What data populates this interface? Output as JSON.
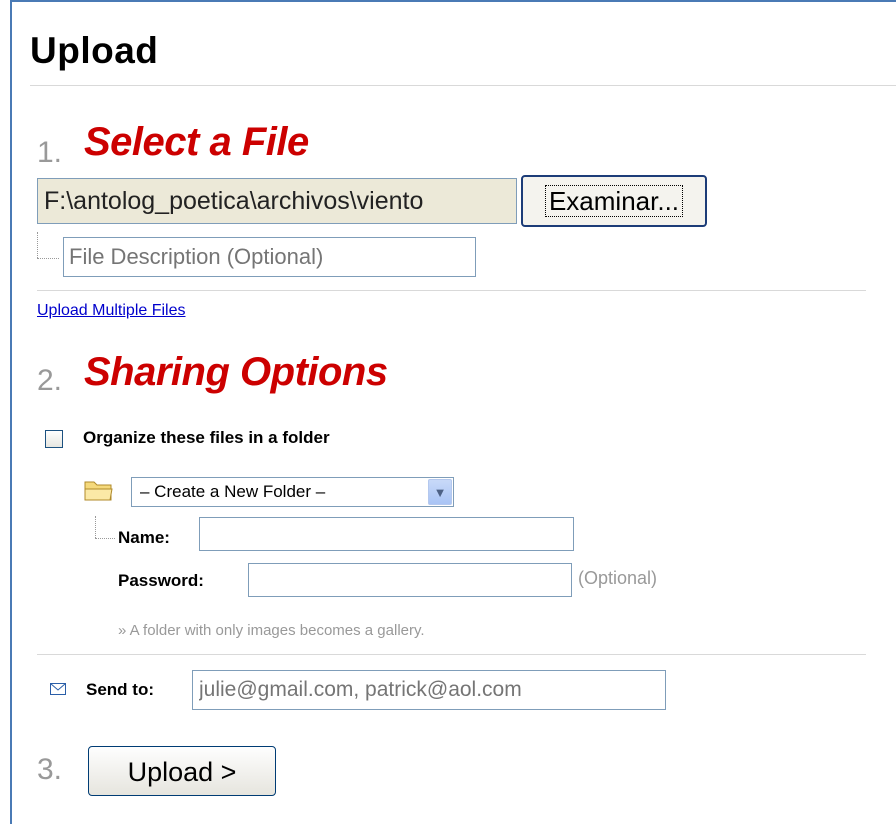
{
  "page": {
    "title": "Upload"
  },
  "step1": {
    "number": "1.",
    "title": "Select a File",
    "file_path": "F:\\antolog_poetica\\archivos\\viento",
    "browse_label": "Examinar...",
    "description_placeholder": "File Description (Optional)",
    "multi_link": "Upload Multiple Files"
  },
  "step2": {
    "number": "2.",
    "title": "Sharing Options",
    "organize_label": "Organize these files in a folder",
    "organize_checked": false,
    "folder_select_value": "– Create a New Folder –",
    "name_label": "Name:",
    "password_label": "Password:",
    "password_optional": "(Optional)",
    "gallery_note": "» A folder with only images becomes a gallery.",
    "send_label": "Send to:",
    "send_placeholder": "julie@gmail.com, patrick@aol.com"
  },
  "step3": {
    "number": "3.",
    "upload_label": "Upload >"
  },
  "colors": {
    "step_title": "#cc0000",
    "step_number": "#999999",
    "link": "#0000cc",
    "frame": "#4a7ab5"
  }
}
